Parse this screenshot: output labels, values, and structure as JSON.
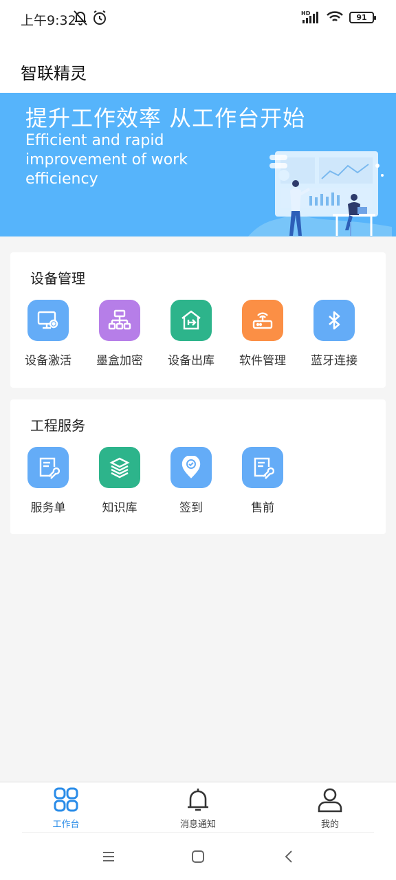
{
  "status_bar": {
    "time": "上午9:32",
    "battery": "91",
    "icons": [
      "bell-off-icon",
      "alarm-icon",
      "hd-signal-icon",
      "wifi-icon",
      "battery-icon"
    ]
  },
  "header": {
    "title": "智联精灵"
  },
  "banner": {
    "title": "提升工作效率 从工作台开始",
    "subtitle": "Efficient and rapid improvement of work efficiency"
  },
  "device_section": {
    "title": "设备管理",
    "items": [
      {
        "label": "设备激活",
        "icon": "monitor-gear-icon",
        "color": "#5aa8f5"
      },
      {
        "label": "墨盒加密",
        "icon": "org-chart-icon",
        "color": "#b67ee8"
      },
      {
        "label": "设备出库",
        "icon": "house-export-icon",
        "color": "#2db48b"
      },
      {
        "label": "软件管理",
        "icon": "router-icon",
        "color": "#fb8f45"
      },
      {
        "label": "蓝牙连接",
        "icon": "bluetooth-icon",
        "color": "#64acf7"
      }
    ]
  },
  "engineering_section": {
    "title": "工程服务",
    "items": [
      {
        "label": "服务单",
        "icon": "service-order-icon",
        "color": "#5aa8f5"
      },
      {
        "label": "知识库",
        "icon": "books-icon",
        "color": "#2db48b"
      },
      {
        "label": "签到",
        "icon": "location-check-icon",
        "color": "#5aa8f5"
      },
      {
        "label": "售前",
        "icon": "presale-doc-icon",
        "color": "#5aa8f5"
      }
    ]
  },
  "bottom_nav": {
    "items": [
      {
        "label": "工作台",
        "icon": "grid-icon",
        "active": true
      },
      {
        "label": "消息通知",
        "icon": "bell-icon",
        "active": false
      },
      {
        "label": "我的",
        "icon": "user-icon",
        "active": false
      }
    ]
  },
  "colors": {
    "accent": "#2a8ce8",
    "banner": "#56b4fb"
  }
}
